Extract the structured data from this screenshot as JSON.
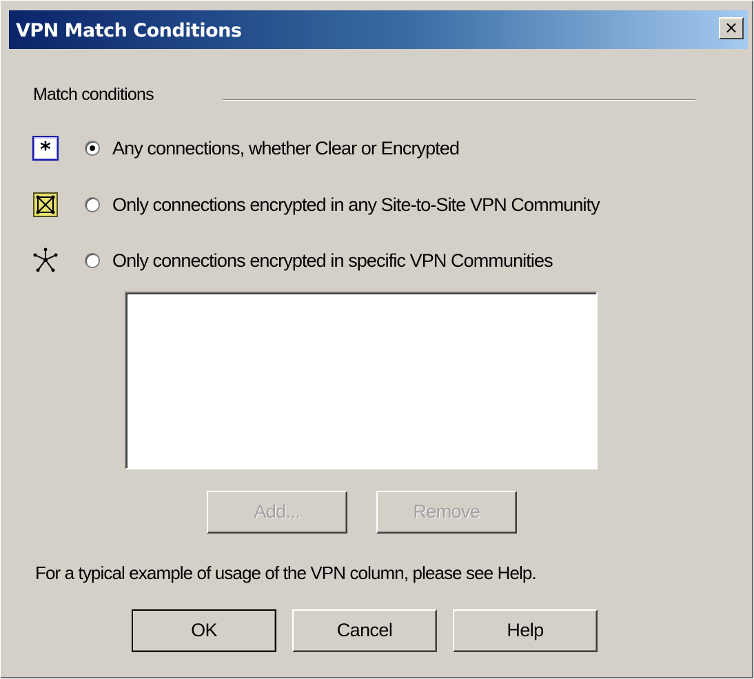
{
  "window": {
    "title": "VPN Match Conditions",
    "close_label": "×"
  },
  "group": {
    "label": "Match conditions"
  },
  "options": [
    {
      "label": "Any connections, whether Clear or Encrypted",
      "selected": true,
      "icon": "asterisk-icon"
    },
    {
      "label": "Only connections encrypted in any Site-to-Site VPN Community",
      "selected": false,
      "icon": "site-to-site-community-icon"
    },
    {
      "label": "Only connections encrypted in specific VPN Communities",
      "selected": false,
      "icon": "vpn-star-community-icon"
    }
  ],
  "communities_list": {
    "items": []
  },
  "list_buttons": {
    "add_label": "Add...",
    "remove_label": "Remove"
  },
  "help_text": "For a typical example of usage of the VPN column, please see Help.",
  "footer_buttons": {
    "ok_label": "OK",
    "cancel_label": "Cancel",
    "help_label": "Help"
  },
  "colors": {
    "title_start": "#0a246a",
    "title_end": "#a6caf0",
    "dialog_bg": "#d4d0c8"
  }
}
